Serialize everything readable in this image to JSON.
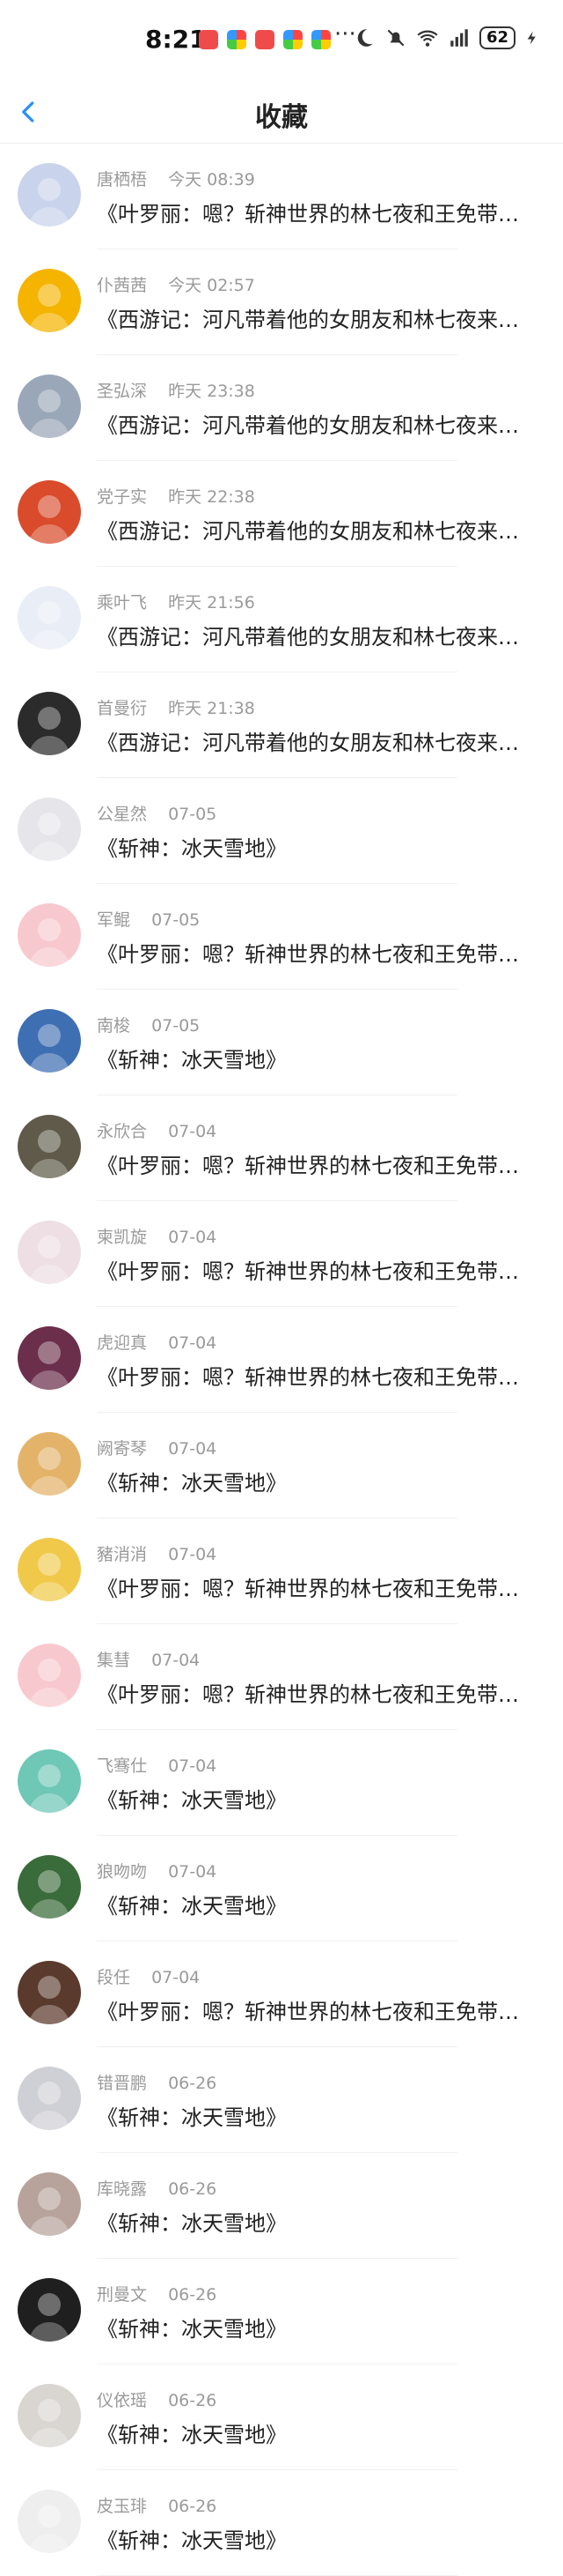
{
  "status": {
    "time": "8:21",
    "dots": "···",
    "battery": "62"
  },
  "header": {
    "title": "收藏"
  },
  "items": [
    {
      "name": "唐栖梧",
      "time": "今天 08:39",
      "text": "《叶罗丽：嗯？斩神世界的林七夜和王免带…",
      "color": "#c9d3ec"
    },
    {
      "name": "仆茜茜",
      "time": "今天 02:57",
      "text": "《西游记：河凡带着他的女朋友和林七夜来…",
      "color": "#f4b400"
    },
    {
      "name": "圣弘深",
      "time": "昨天 23:38",
      "text": "《西游记：河凡带着他的女朋友和林七夜来…",
      "color": "#9aa7b8"
    },
    {
      "name": "党子实",
      "time": "昨天 22:38",
      "text": "《西游记：河凡带着他的女朋友和林七夜来…",
      "color": "#d94b2b"
    },
    {
      "name": "乘叶飞",
      "time": "昨天 21:56",
      "text": "《西游记：河凡带着他的女朋友和林七夜来…",
      "color": "#e9eef6"
    },
    {
      "name": "首曼衍",
      "time": "昨天 21:38",
      "text": "《西游记：河凡带着他的女朋友和林七夜来…",
      "color": "#2b2b2b"
    },
    {
      "name": "公星然",
      "time": "07-05",
      "text": "《斩神：冰天雪地》",
      "color": "#e6e6ea"
    },
    {
      "name": "军鲲",
      "time": "07-05",
      "text": "《叶罗丽：嗯？斩神世界的林七夜和王免带…",
      "color": "#f7c9cf"
    },
    {
      "name": "南梭",
      "time": "07-05",
      "text": "《斩神：冰天雪地》",
      "color": "#3f6fb3"
    },
    {
      "name": "永欣合",
      "time": "07-04",
      "text": "《叶罗丽：嗯？斩神世界的林七夜和王免带…",
      "color": "#5f5a4a"
    },
    {
      "name": "柬凯旋",
      "time": "07-04",
      "text": "《叶罗丽：嗯？斩神世界的林七夜和王免带…",
      "color": "#eedfe4"
    },
    {
      "name": "虎迎真",
      "time": "07-04",
      "text": "《叶罗丽：嗯？斩神世界的林七夜和王免带…",
      "color": "#6b2e4b"
    },
    {
      "name": "阙寄琴",
      "time": "07-04",
      "text": "《斩神：冰天雪地》",
      "color": "#e4b36a"
    },
    {
      "name": "豬消消",
      "time": "07-04",
      "text": "《叶罗丽：嗯？斩神世界的林七夜和王免带…",
      "color": "#f0c94a"
    },
    {
      "name": "集彗",
      "time": "07-04",
      "text": "《叶罗丽：嗯？斩神世界的林七夜和王免带…",
      "color": "#f7c9cf"
    },
    {
      "name": "飞骞仕",
      "time": "07-04",
      "text": "《斩神：冰天雪地》",
      "color": "#6fc7b6"
    },
    {
      "name": "狼吻吻",
      "time": "07-04",
      "text": "《斩神：冰天雪地》",
      "color": "#3a6b3a"
    },
    {
      "name": "段任",
      "time": "07-04",
      "text": "《叶罗丽：嗯？斩神世界的林七夜和王免带…",
      "color": "#5a3a2c"
    },
    {
      "name": "错晋鹏",
      "time": "06-26",
      "text": "《斩神：冰天雪地》",
      "color": "#cfcfd6"
    },
    {
      "name": "库晓露",
      "time": "06-26",
      "text": "《斩神：冰天雪地》",
      "color": "#b7a39b"
    },
    {
      "name": "刑曼文",
      "time": "06-26",
      "text": "《斩神：冰天雪地》",
      "color": "#1f1f1f"
    },
    {
      "name": "仪依瑶",
      "time": "06-26",
      "text": "《斩神：冰天雪地》",
      "color": "#d9d6d2"
    },
    {
      "name": "皮玉琲",
      "time": "06-26",
      "text": "《斩神：冰天雪地》",
      "color": "#eeeeee"
    }
  ]
}
